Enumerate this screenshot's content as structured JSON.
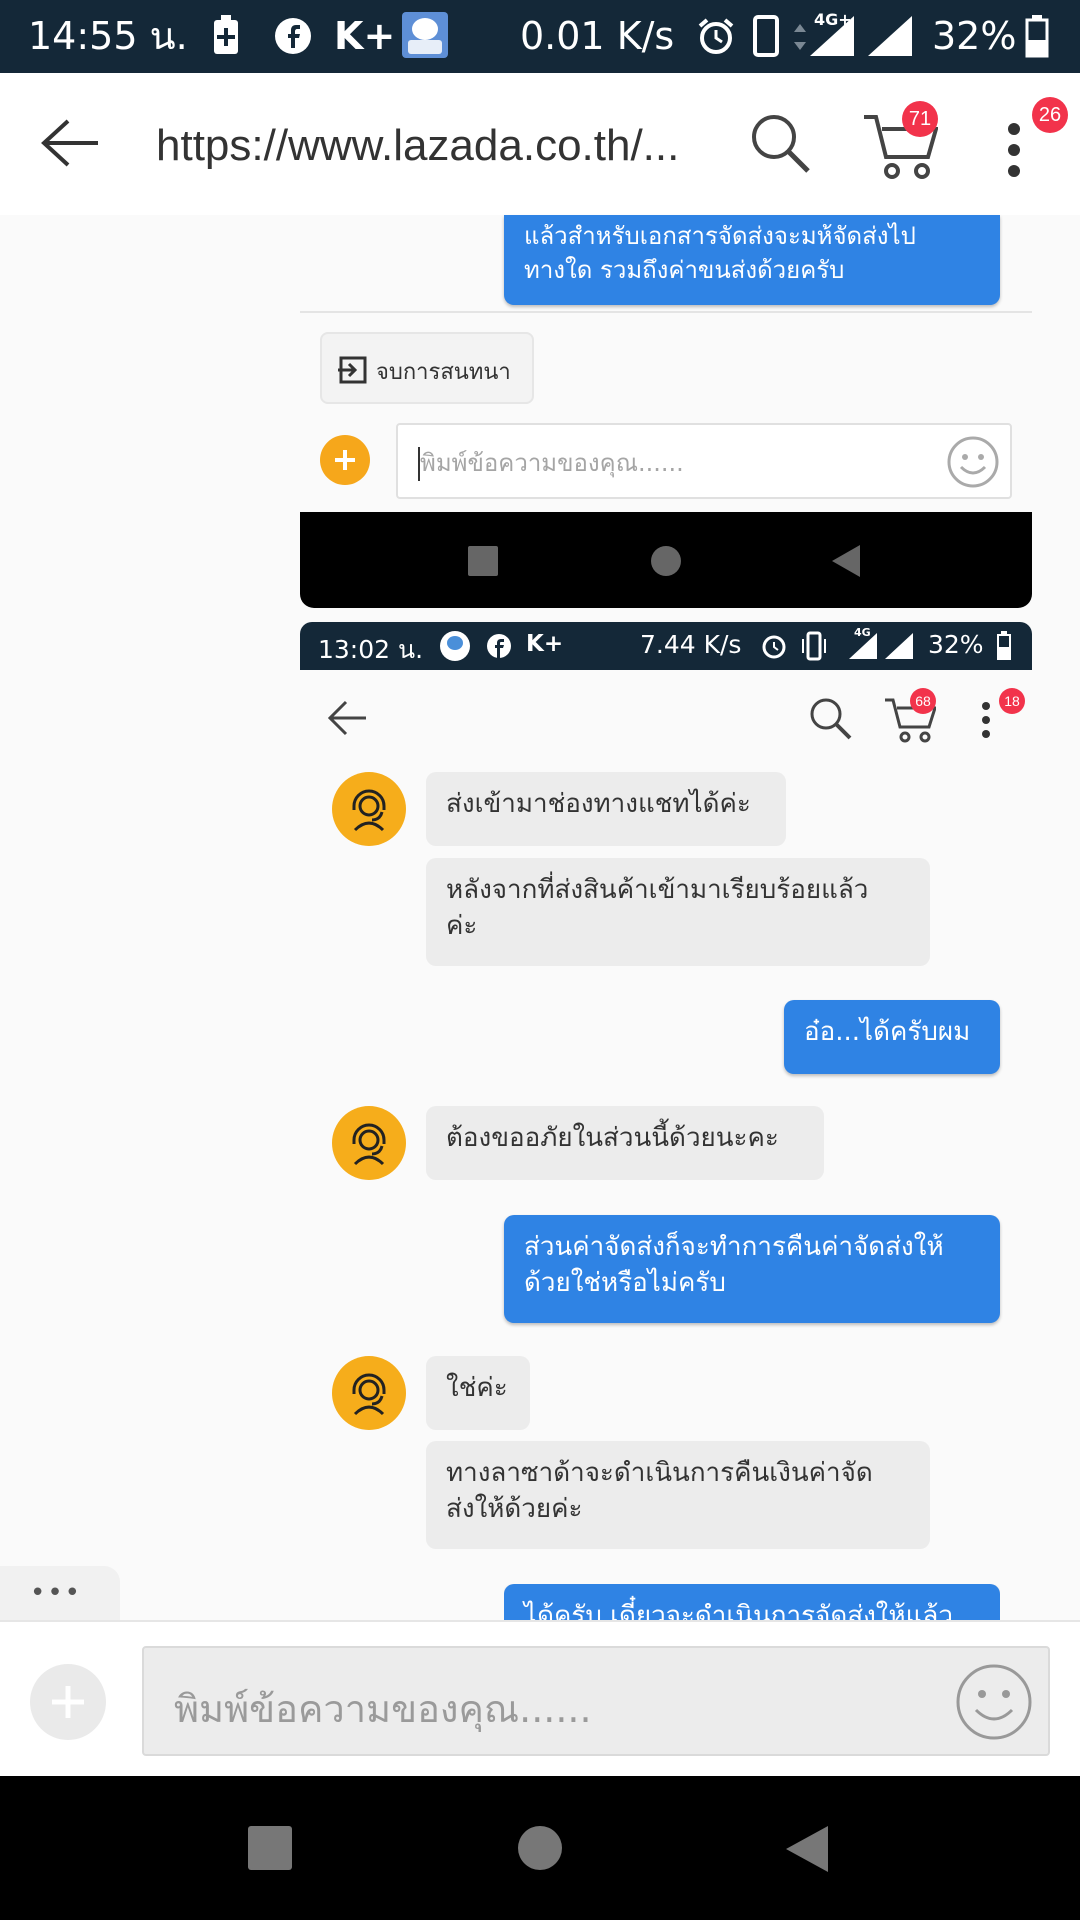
{
  "status_bar": {
    "time": "14:55 น.",
    "net_speed": "0.01 K/s",
    "network": "4G+",
    "battery": "32%",
    "k_plus": "K+"
  },
  "browser": {
    "url": "https://www.lazada.co.th/...",
    "cart_count": "71",
    "menu_count": "26"
  },
  "embedded_top": {
    "last_outgoing": "แล้วสำหรับเอกสารจัดส่งจะมห้จัดส่งไป\nทางใด รวมถึงค่าขนส่งด้วยครับ",
    "end_chat_label": "จบการสนทนา",
    "input_placeholder": "พิมพ์ข้อความของคุณ......"
  },
  "embedded_screenshot": {
    "status": {
      "time": "13:02 น.",
      "net_speed": "7.44 K/s",
      "network": "4G",
      "battery": "32%",
      "k_plus": "K+"
    },
    "cart_count": "68",
    "menu_count": "18",
    "messages": [
      {
        "side": "in",
        "text": "ส่งเข้ามาช่องทางแชทได้ค่ะ"
      },
      {
        "side": "in",
        "text": "หลังจากที่ส่งสินค้าเข้ามาเรียบร้อยแล้ว\nค่ะ"
      },
      {
        "side": "out",
        "text": "อ๋อ...ได้ครับผม"
      },
      {
        "side": "in",
        "text": "ต้องขออภัยในส่วนนี้ด้วยนะคะ"
      },
      {
        "side": "out",
        "text": "ส่วนค่าจัดส่งก็จะทำการคืนค่าจัดส่งให้\nด้วยใช่หรือไม่ครับ"
      },
      {
        "side": "in",
        "text": "ใช่ค่ะ"
      },
      {
        "side": "in",
        "text": "ทางลาซาด้าจะดำเนินการคืนเงินค่าจัด\nส่งให้ด้วยค่ะ"
      },
      {
        "side": "out",
        "text": "ได้ครับ เดี๋ยวจะดำเนินการจัดส่งให้แล้ว"
      }
    ]
  },
  "outer_input": {
    "placeholder": "พิมพ์ข้อความของคุณ......",
    "more_label": "•••"
  }
}
